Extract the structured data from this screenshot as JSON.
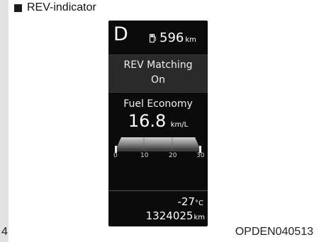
{
  "header": {
    "label": "REV-indicator"
  },
  "page_number_left": "4",
  "caption": "OPDEN040513",
  "cluster": {
    "gear": "D",
    "fuel_icon": "fuel-pump-icon",
    "range": {
      "value": "596",
      "unit": "km"
    },
    "rev_matching": {
      "title": "REV Matching",
      "state": "On"
    },
    "fuel_economy": {
      "title": "Fuel Economy",
      "value": "16.8",
      "unit": "km/L",
      "gauge": {
        "ticks": [
          "0",
          "10",
          "20",
          "30"
        ],
        "min": 0,
        "max": 30
      }
    },
    "temperature": {
      "value": "-27",
      "unit": "°C"
    },
    "odometer": {
      "value": "1324025",
      "unit": "km"
    }
  },
  "colors": {
    "cluster_bg": "#0b0b0b",
    "panel_bg": "#2a2a2a",
    "text": "#ffffff"
  }
}
